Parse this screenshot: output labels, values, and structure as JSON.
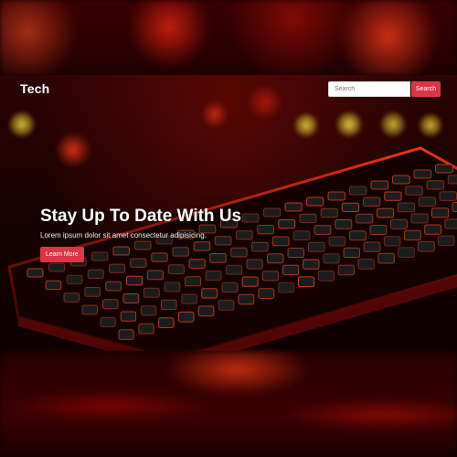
{
  "navbar": {
    "brand": "Tech",
    "search": {
      "placeholder": "Search",
      "value": "",
      "button_label": "Search"
    }
  },
  "hero": {
    "title": "Stay Up To Date With Us",
    "text": "Lorem ipsum dolor sit amet consectetur adipisicing.",
    "button_label": "Learn More"
  },
  "colors": {
    "accent": "#dc3545",
    "background": "#1a0202",
    "text": "#ffffff"
  }
}
